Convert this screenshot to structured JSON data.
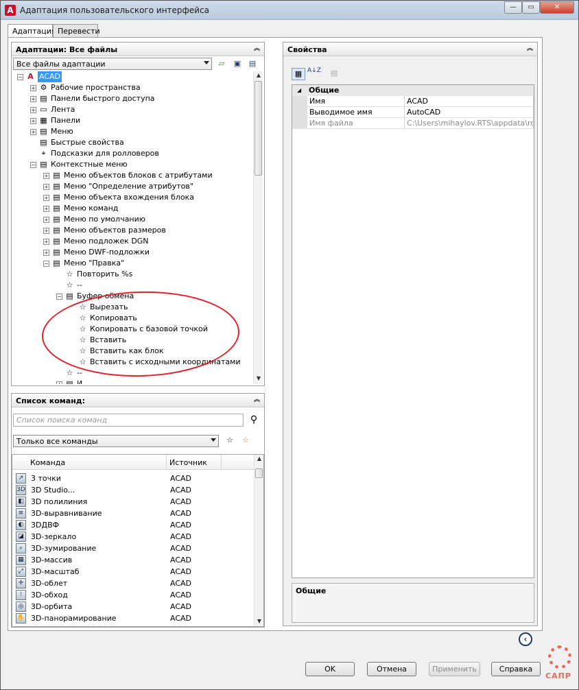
{
  "window": {
    "title": "Адаптация пользовательского интерфейса",
    "app_icon": "A",
    "buttons": {
      "minimize": "—",
      "maximize": "▭",
      "close": "✕"
    }
  },
  "tabs": [
    {
      "label": "Адаптация",
      "active": true
    },
    {
      "label": "Перевести",
      "active": false
    }
  ],
  "customizations_panel": {
    "title": "Адаптации: Все файлы",
    "file_filter": "Все файлы адаптации",
    "tree": [
      {
        "label": "ACAD",
        "icon": "A",
        "selected": true,
        "expanded": true
      },
      {
        "label": "Рабочие пространства",
        "icon": "⚙"
      },
      {
        "label": "Панели быстрого доступа",
        "icon": "▤"
      },
      {
        "label": "Лента",
        "icon": "▭"
      },
      {
        "label": "Панели",
        "icon": "▦"
      },
      {
        "label": "Меню",
        "icon": "▤"
      },
      {
        "label": "Быстрые свойства",
        "icon": "▤"
      },
      {
        "label": "Подсказки для ролловеров",
        "icon": "⌖"
      },
      {
        "label": "Контекстные меню",
        "icon": "▤"
      },
      {
        "label": "Меню объектов блоков с атрибутами",
        "icon": "▤"
      },
      {
        "label": "Меню \"Определение атрибутов\"",
        "icon": "▤"
      },
      {
        "label": "Меню объекта вхождения блока",
        "icon": "▤"
      },
      {
        "label": "Меню команд",
        "icon": "▤"
      },
      {
        "label": "Меню по умолчанию",
        "icon": "▤"
      },
      {
        "label": "Меню объектов размеров",
        "icon": "▤"
      },
      {
        "label": "Меню подложек DGN",
        "icon": "▤"
      },
      {
        "label": "Меню DWF-подложки",
        "icon": "▤"
      },
      {
        "label": "Меню \"Правка\"",
        "icon": "▤"
      },
      {
        "label": "Повторить %s",
        "icon": "☆"
      },
      {
        "label": "--",
        "icon": "☆"
      },
      {
        "label": "Буфер обмена",
        "icon": "▤"
      },
      {
        "label": "Вырезать",
        "icon": "☆"
      },
      {
        "label": "Копировать",
        "icon": "☆"
      },
      {
        "label": "Копировать с базовой точкой",
        "icon": "☆"
      },
      {
        "label": "Вставить",
        "icon": "☆"
      },
      {
        "label": "Вставить как блок",
        "icon": "☆"
      },
      {
        "label": "Вставить с исходными координатами",
        "icon": "☆"
      },
      {
        "label": "--",
        "icon": "☆"
      },
      {
        "label": "И",
        "icon": "▤"
      }
    ]
  },
  "command_list_panel": {
    "title": "Список команд:",
    "search_placeholder": "Список поиска команд",
    "filter": "Только все команды",
    "columns": [
      "Команда",
      "Источник"
    ],
    "rows": [
      {
        "icon": "↗",
        "name": "3 точки",
        "source": "ACAD"
      },
      {
        "icon": "3D",
        "name": "3D Studio...",
        "source": "ACAD"
      },
      {
        "icon": "◧",
        "name": "3D полилиния",
        "source": "ACAD"
      },
      {
        "icon": "≡",
        "name": "3D-выравнивание",
        "source": "ACAD"
      },
      {
        "icon": "◐",
        "name": "3DДВФ",
        "source": "ACAD"
      },
      {
        "icon": "◪",
        "name": "3D-зеркало",
        "source": "ACAD"
      },
      {
        "icon": "⌕",
        "name": "3D-зумирование",
        "source": "ACAD"
      },
      {
        "icon": "▦",
        "name": "3D-массив",
        "source": "ACAD"
      },
      {
        "icon": "⤢",
        "name": "3D-масштаб",
        "source": "ACAD"
      },
      {
        "icon": "✛",
        "name": "3D-облет",
        "source": "ACAD"
      },
      {
        "icon": "⁝",
        "name": "3D-обход",
        "source": "ACAD"
      },
      {
        "icon": "◎",
        "name": "3D-орбита",
        "source": "ACAD"
      },
      {
        "icon": "✋",
        "name": "3D-панорамирование",
        "source": "ACAD"
      }
    ]
  },
  "properties_panel": {
    "title": "Свойства",
    "category": "Общие",
    "rows": [
      {
        "name": "Имя",
        "value": "ACAD",
        "disabled": false
      },
      {
        "name": "Выводимое имя",
        "value": "AutoCAD",
        "disabled": false
      },
      {
        "name": "Имя файла",
        "value": "C:\\Users\\mihaylov.RTS\\appdata\\roan",
        "disabled": true
      }
    ],
    "description_title": "Общие"
  },
  "footer": {
    "ok": "OK",
    "cancel": "Отмена",
    "apply": "Применить",
    "help": "Справка"
  },
  "watermark": "САПР"
}
